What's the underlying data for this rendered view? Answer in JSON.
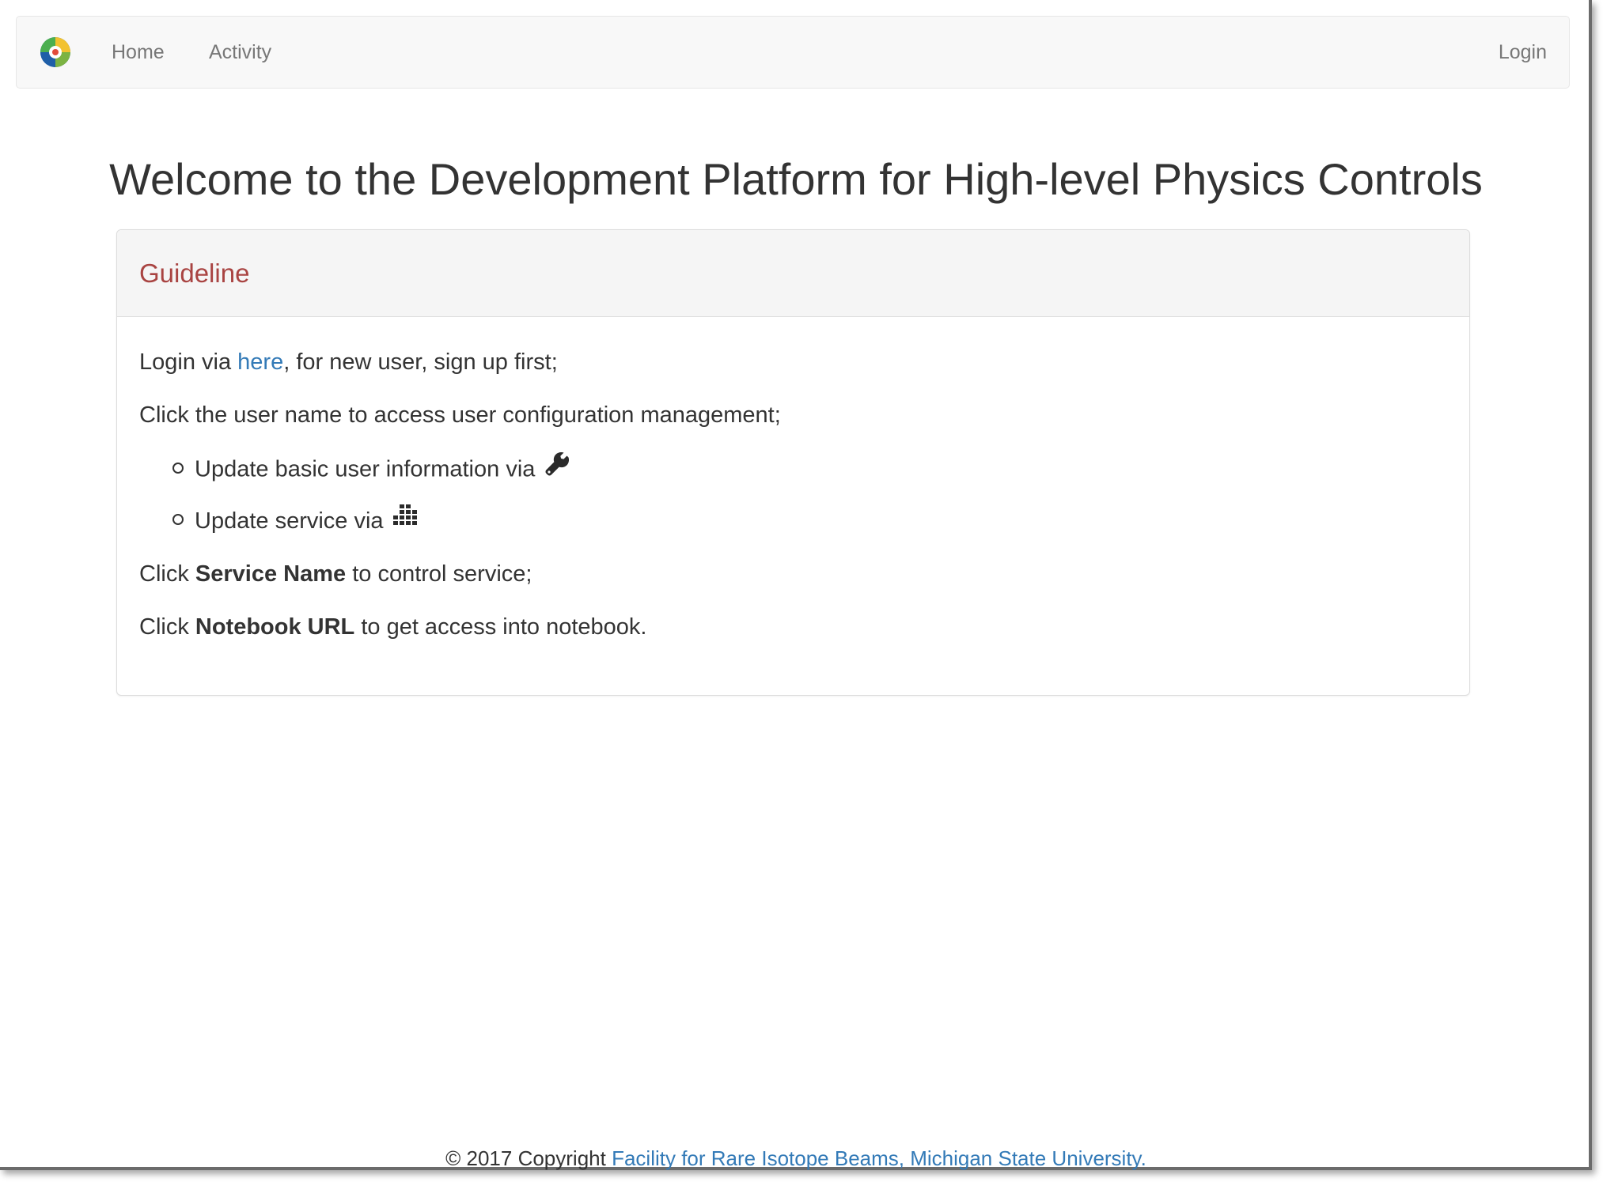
{
  "navbar": {
    "logo_icon": "atom-logo-icon",
    "home_label": "Home",
    "activity_label": "Activity",
    "login_label": "Login"
  },
  "main": {
    "title": "Welcome to the Development Platform for High-level Physics Controls"
  },
  "panel": {
    "heading": "Guideline",
    "line1_pre": "Login via ",
    "line1_link": "here",
    "line1_post": ", for new user, sign up first;",
    "line2": "Click the user name to access user configuration management;",
    "line3_text": "Update basic user information via ",
    "line3_icon": "wrench-icon",
    "line4_text": "Update service via ",
    "line4_icon": "tasks-icon",
    "line5_pre": "Click ",
    "line5_bold": "Service Name",
    "line5_post": " to control service;",
    "line6_pre": "Click ",
    "line6_bold": "Notebook URL",
    "line6_post": " to get access into notebook."
  },
  "footer": {
    "copyright": "© 2017 Copyright ",
    "org_link": "Facility for Rare Isotope Beams, Michigan State University."
  },
  "colors": {
    "navbar_bg": "#f8f8f8",
    "panel_heading_text": "#a94442",
    "link": "#337ab7",
    "nav_text": "#777777"
  }
}
